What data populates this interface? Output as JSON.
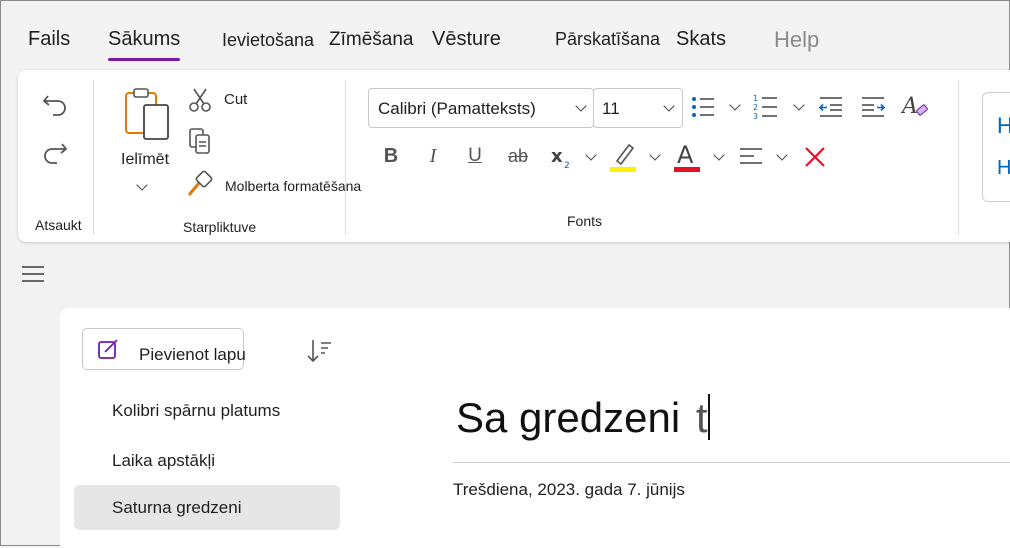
{
  "menu": {
    "tabs": [
      {
        "label": "Fails"
      },
      {
        "label": "Sākums"
      },
      {
        "label": "Ievietošana"
      },
      {
        "label": "Zīmēšana"
      },
      {
        "label": "Vēsture"
      },
      {
        "label": "Pārskatīšana"
      },
      {
        "label": "Skats"
      },
      {
        "label": "Help"
      }
    ],
    "active_tab": "Sākums"
  },
  "ribbon": {
    "undo_group": {
      "label": "Atsaukt"
    },
    "clipboard": {
      "label": "Starpliktuve",
      "paste_label": "Ielīmēt",
      "cut_label": "Cut",
      "copy_label": "",
      "format_painter_label": "Molberta formatēšana"
    },
    "font": {
      "label": "Fonts",
      "font_name": "Calibri (Pamatteksts)",
      "font_size": "11",
      "highlight_color": "#ffef00",
      "font_color": "#e81123"
    },
    "styles_partial": {
      "line1": "H",
      "line2": "H"
    }
  },
  "colors": {
    "accent": "#7719aa",
    "clear_format": "#e81123"
  },
  "sidebar": {
    "add_page_label": "Pievienot lapu",
    "pages": [
      {
        "title": "Kolibri spārnu platums"
      },
      {
        "title": "Laika apstākļi"
      },
      {
        "title": "Saturna gredzeni"
      }
    ],
    "selected_index": 2
  },
  "page": {
    "title": "Sa gredzeni",
    "typing": "t",
    "date": "Trešdiena, 2023. gada 7. jūnijs"
  }
}
